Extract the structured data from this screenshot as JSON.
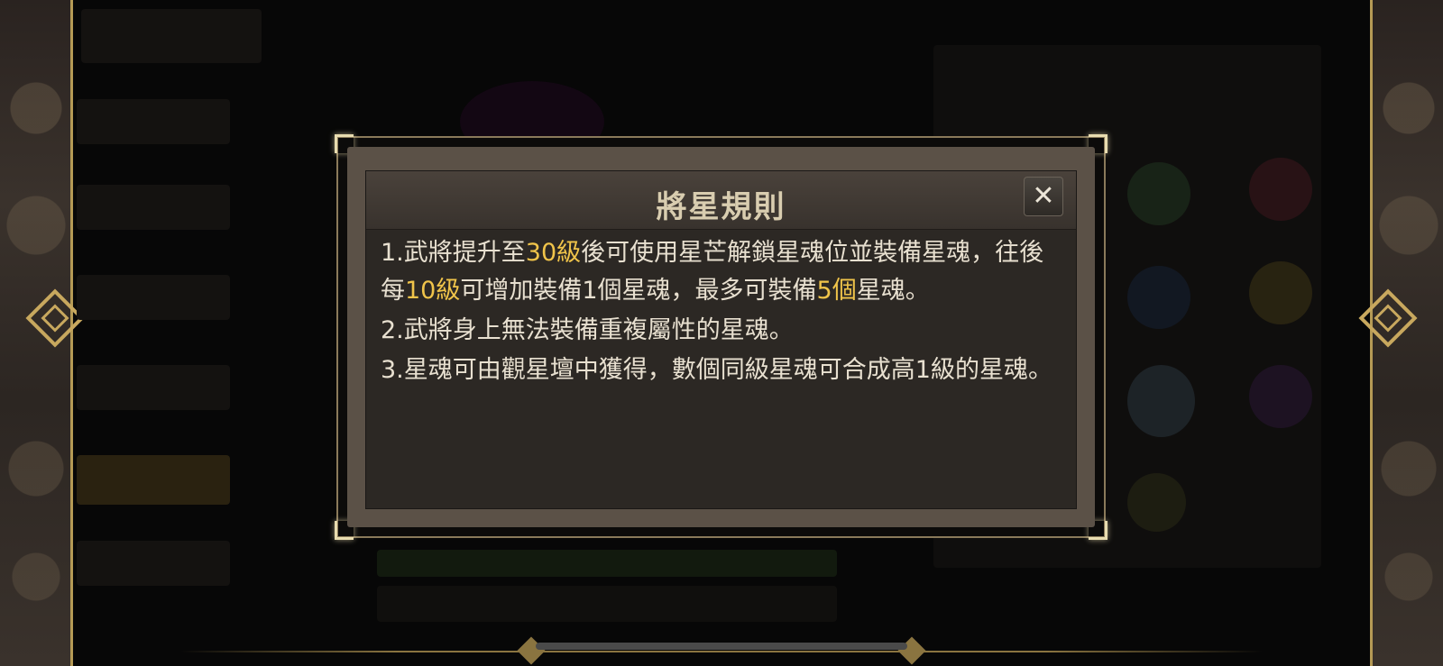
{
  "dialog": {
    "title": "將星規則",
    "close_label": "✕",
    "rules": [
      {
        "p1": "1.武將提升至",
        "h1": "30級",
        "p2": "後可使用星芒解鎖星魂位並裝備星魂，往後每",
        "h2": "10級",
        "p3": "可增加裝備1個星魂，最多可裝備",
        "h3": "5個",
        "p4": "星魂。"
      },
      {
        "text": "2.武將身上無法裝備重複屬性的星魂。"
      },
      {
        "text": "3.星魂可由觀星壇中獲得，數個同級星魂可合成高1級的星魂。"
      }
    ]
  },
  "colors": {
    "highlight": "#f0c44a",
    "text": "#e8e0d0",
    "title": "#d9cdb0",
    "frame_gold": "#b59a55"
  }
}
